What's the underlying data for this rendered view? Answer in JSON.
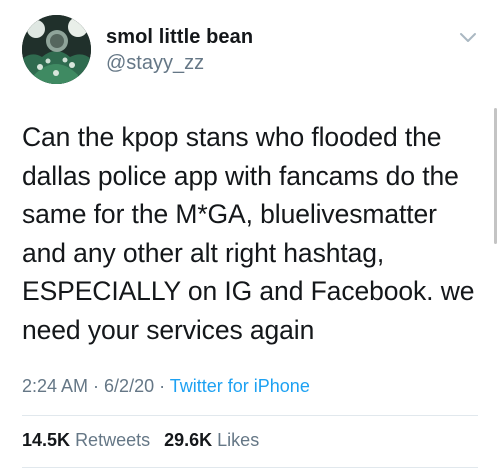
{
  "user": {
    "display_name": "smol little bean",
    "handle": "@stayy_zz"
  },
  "tweet": {
    "text": "Can the kpop stans who flooded the\ndallas police app with fancams do the\nsame for the M*GA, bluelivesmatter\nand any other alt right hashtag,\nESPECIALLY on IG and Facebook. we\nneed your services again",
    "time": "2:24 AM",
    "separator1": " · ",
    "date": "6/2/20",
    "separator2": " · ",
    "source": "Twitter for iPhone"
  },
  "stats": {
    "retweets_count": "14.5K",
    "retweets_label": "Retweets",
    "likes_count": "29.6K",
    "likes_label": "Likes"
  },
  "icons": {
    "menu": "chevron-down-icon",
    "avatar": "avatar"
  },
  "colors": {
    "text": "#14171a",
    "secondary": "#657786",
    "link": "#1da1f2",
    "divider": "#e1e8ed"
  }
}
